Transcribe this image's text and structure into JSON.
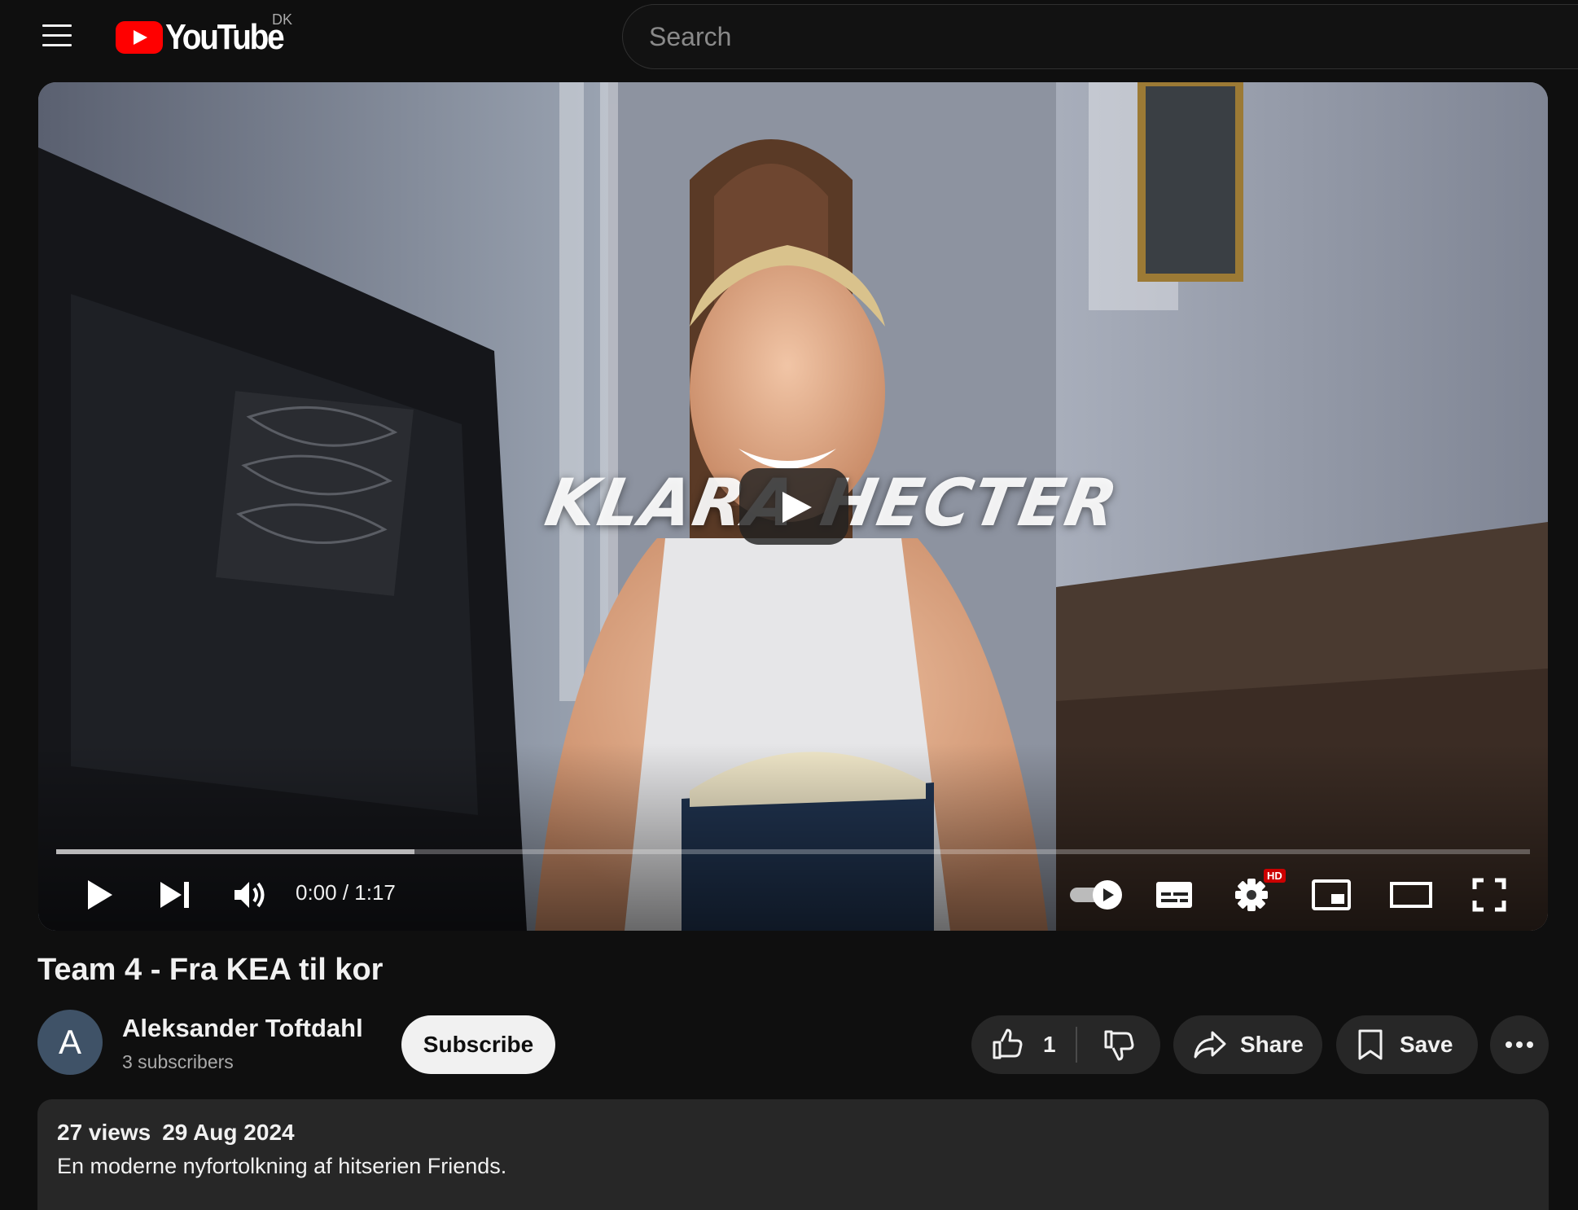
{
  "header": {
    "logo_text": "YouTube",
    "country_code": "DK",
    "search_placeholder": "Search"
  },
  "player": {
    "overlay_title": "KLARA HECTER",
    "time_display": "0:00 / 1:17",
    "progress_loaded_fraction": 0.243,
    "settings_badge": "HD",
    "autoplay_on": true
  },
  "video": {
    "title": "Team 4 - Fra KEA til kor"
  },
  "channel": {
    "avatar_letter": "A",
    "name": "Aleksander Toftdahl",
    "subscribers": "3 subscribers",
    "subscribe_label": "Subscribe"
  },
  "actions": {
    "like_count": "1",
    "share_label": "Share",
    "save_label": "Save"
  },
  "description": {
    "views": "27 views",
    "date": "29 Aug 2024",
    "text": "En moderne nyfortolkning af hitserien Friends."
  },
  "colors": {
    "background": "#0f0f0f",
    "brand_red": "#ff0000",
    "pill_bg": "#272727",
    "text_primary": "#f1f1f1",
    "text_secondary": "#aaaaaa"
  }
}
